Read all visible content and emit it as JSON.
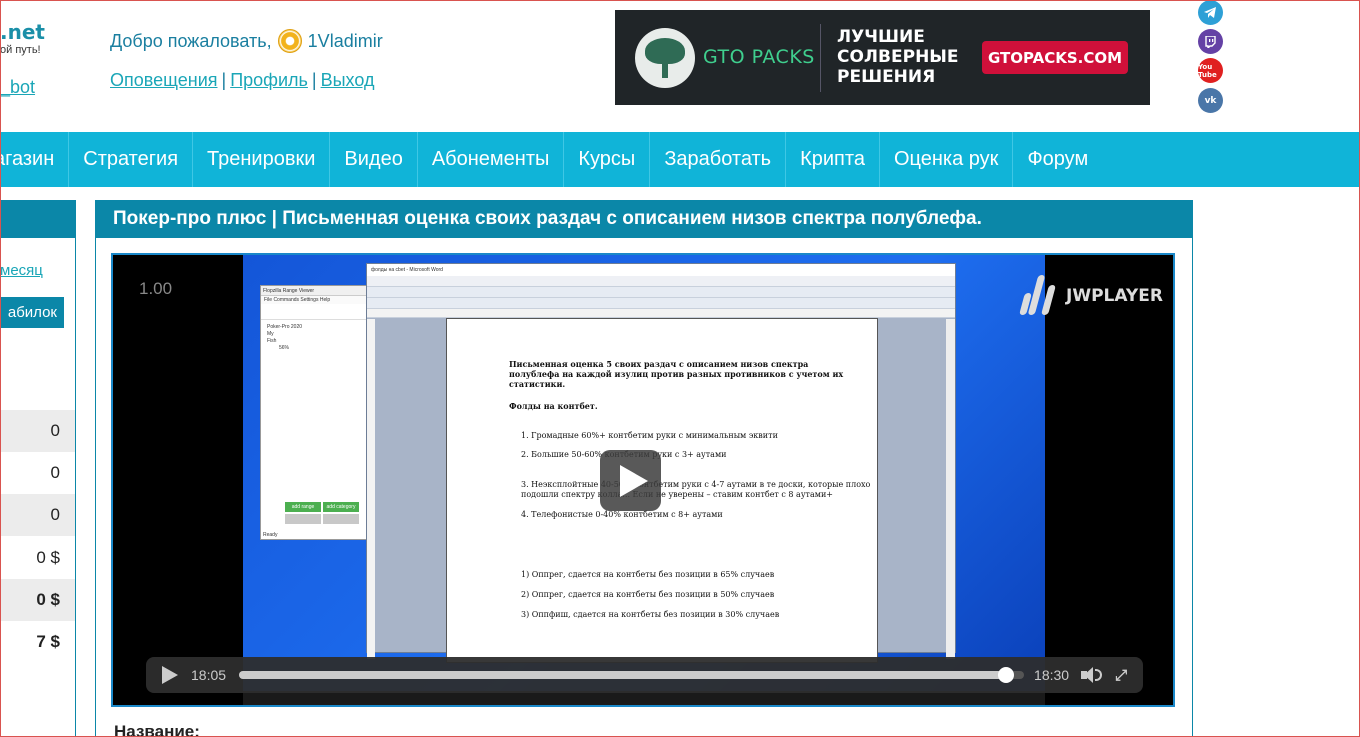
{
  "header": {
    "logo_text": "net",
    "tagline": "ой путь!",
    "bot_link": "_bot",
    "welcome_text": "Добро пожаловать,",
    "username": "1Vladimir",
    "links": [
      "Оповещения",
      "Профиль",
      "Выход"
    ],
    "link_separator": "|"
  },
  "banner": {
    "brand": "GTO PACKS",
    "slogan": "ЛУЧШИЕ СОЛВЕРНЫЕ РЕШЕНИЯ",
    "cta": "GTOPACKS.COM"
  },
  "social": {
    "items": [
      "telegram-icon",
      "twitch-icon",
      "youtube-icon",
      "vk-icon"
    ],
    "youtube_text": "You Tube",
    "vk_text": "vk"
  },
  "nav": {
    "items": [
      "агазин",
      "Стратегия",
      "Тренировки",
      "Видео",
      "Абонементы",
      "Курсы",
      "Заработать",
      "Крипта",
      "Оценка рук",
      "Форум"
    ]
  },
  "sidebar": {
    "month_link": "месяц",
    "button": "абилок",
    "rows": [
      "0",
      "0",
      "0",
      "0 $",
      "0 $",
      "7 $"
    ]
  },
  "main": {
    "title": "Покер-про плюс | Письменная оценка своих раздач с описанием низов спектра полублефа.",
    "name_label": "Название:"
  },
  "player": {
    "speed": "1.00",
    "brand": "JWPLAYER",
    "current_time": "18:05",
    "duration": "18:30",
    "progress": 0.977
  },
  "video_content": {
    "word_title": "фолды на cbet - Microsoft Word",
    "doc_title": "Письменная оценка 5 своих раздач с описанием низов спектра полублефа на каждой изулиц против разных противников с учетом их статистики.",
    "section_heading": "Фолды на контбет.",
    "items": [
      "1.   Громадные    60%+               контбетим руки с минимальным эквити",
      "2.   Большие     50-60%              контбетим руки с 3+ аутами",
      "3.   Неэксплойтные     40-50%              контбетим руки с 4-7 аутами в те доски, которые плохо",
      "       подошли спектру колла... Если не уверены  – ставим контбет с 8 аутами+",
      "4.   Телефонистые 0-40%            контбетим с 8+ аутами",
      "1)   Оппрег, сдается на контбеты без позиции в 65% случаев",
      "2)   Оппрег, сдается на контбеты без позиции в 50% случаев",
      "3)   Оппфиш, сдается на контбеты без позиции в 30% случаев"
    ],
    "range_window": {
      "title": "Flopzilla Range Viewer",
      "menu": "File  Commands  Settings  Help",
      "tree": [
        "Poker-Pro 2020",
        "My",
        "Fish",
        "56%"
      ],
      "add_range": "add range",
      "add_category": "add category",
      "status": "Ready"
    }
  }
}
